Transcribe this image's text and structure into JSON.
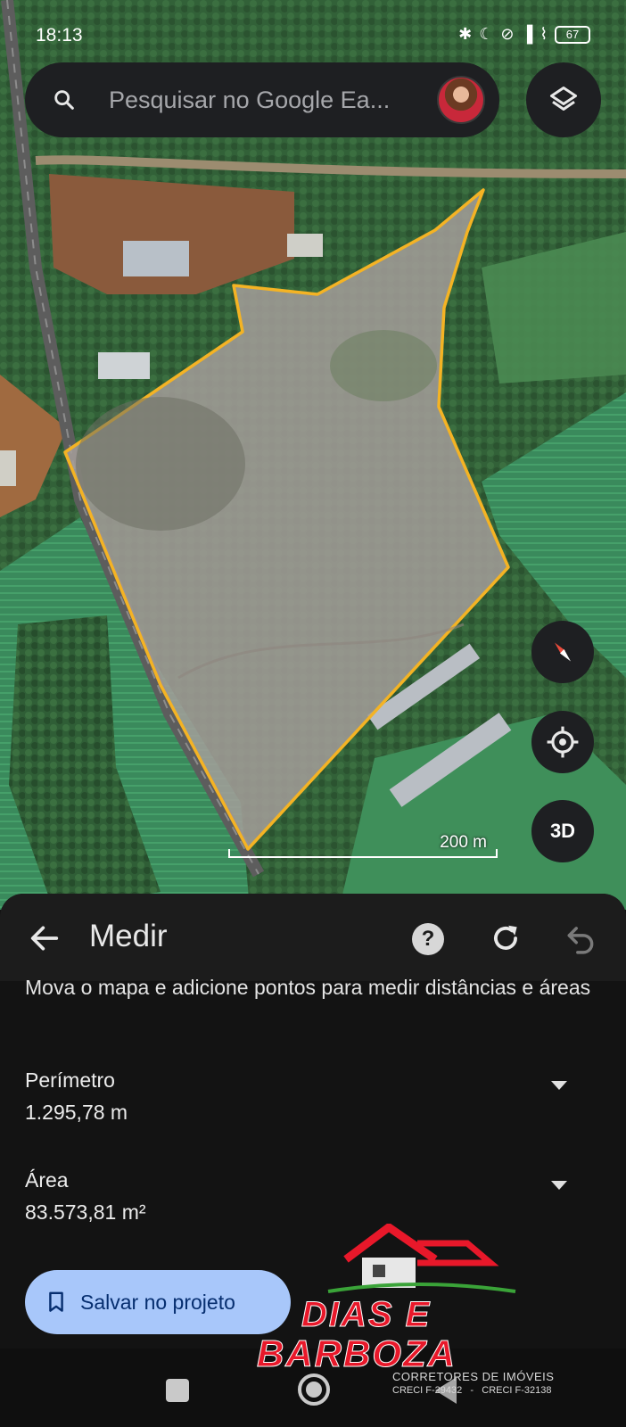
{
  "status_bar": {
    "time": "18:13",
    "battery": "67",
    "icons": [
      "bluetooth-icon",
      "do-not-disturb-icon",
      "mute-icon",
      "signal-icon",
      "wifi-icon",
      "battery-icon"
    ]
  },
  "search": {
    "placeholder": "Pesquisar no Google Ea..."
  },
  "map": {
    "scale_label": "200 m",
    "compass_icon": "compass-icon",
    "location_icon": "my-location-icon",
    "three_d_label": "3D",
    "polygon_color": "#f4b324"
  },
  "sheet": {
    "title": "Medir",
    "instructions": "Mova o mapa e adicione pontos para medir distâncias e áreas",
    "metrics": [
      {
        "label": "Perímetro",
        "value": "1.295,78 m"
      },
      {
        "label": "Área",
        "value": "83.573,81 m²"
      }
    ],
    "save_label": "Salvar no projeto",
    "accent": "#a8c7fa"
  },
  "watermark": {
    "line1": "DIAS E",
    "line2": "BARBOZA",
    "subtitle": "CORRETORES DE IMÓVEIS",
    "creci": "CRECI F-29432   -   CRECI F-32138"
  }
}
